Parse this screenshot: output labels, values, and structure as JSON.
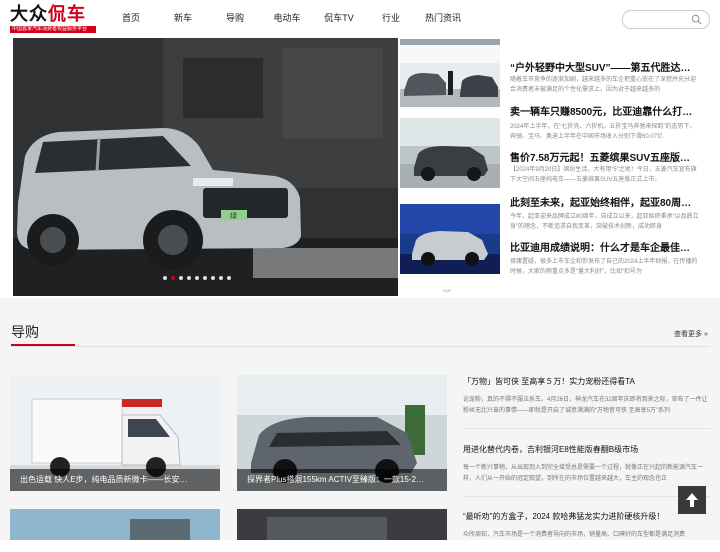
{
  "header": {
    "logo_text_1": "大众",
    "logo_text_2": "侃车",
    "logo_tagline": "中国首家汽车消费者权益服务平台",
    "nav": [
      {
        "label": "首页",
        "active": true
      },
      {
        "label": "新车",
        "active": false
      },
      {
        "label": "导购",
        "active": false
      },
      {
        "label": "电动车",
        "active": false
      },
      {
        "label": "侃车TV",
        "active": false
      },
      {
        "label": "行业",
        "active": false
      },
      {
        "label": "热门资讯",
        "active": false
      }
    ],
    "search": {
      "placeholder": "",
      "icon": "search-icon"
    }
  },
  "hero": {
    "slide_count": 9,
    "active_slide": 2,
    "plate": "绿"
  },
  "side_news": [
    {
      "title": "“户外轻野中大型SUV”——第五代胜达…",
      "desc": "随着车市竞争的逐渐加剧，越来越多的车企把重心放在了深挖并充分迎合消费者未被满足的个性化需求上。因为对于越来越多的"
    },
    {
      "title": "卖一辆车只赚8500元，比亚迪靠什么打…",
      "desc": "2024年上半年，在“七折壳、六折机，五折宝马奔驰来探韵”的态势下，奔驰、宝马、奥迪上半年在中国市场收入分别下滑60.07亿"
    },
    {
      "title": "售价7.58万元起！五菱缤果SUV五座版…",
      "desc": "【2024年9月20日】缤纷生活，大有用“5”之地！今日，五菱汽车宣布旗下大空间五座纯电车——五菱缤果SUV五座版正式上市，"
    },
    {
      "title": "此刻至未来，起亚始终相伴，起亚80周…",
      "desc": "今年，起亚迎来品牌成立80周年，自成立以来，起亚始终秉承“以品质立身”的理念，不断追求自我变革，突破技术创新，成功跻身"
    },
    {
      "title": "比亚迪用成绩说明：什么才是车企最佳…",
      "desc": "毋庸置疑，很多上市车企和你发布了自己的2024上半年财报，在传播的时候，大家的侧重点多是“量大利好”，比如“扣号为"
    }
  ],
  "more_arrows": "︾",
  "guide": {
    "title": "导购",
    "view_more": "查看更多 »",
    "cards": [
      {
        "caption": "出色运载 快人E步，纯电品质新微卡——长安…"
      },
      {
        "caption": "探界者Plus搭混155km ACTIV至臻版：一款15-2…"
      },
      {
        "caption": ""
      },
      {
        "caption": ""
      }
    ],
    "news": [
      {
        "title": "「万物」皆可侠 至高享５万！实力宠粉还得看TA",
        "desc": "论宠粉，真的不得不服法系车。4月26日，神龙汽车在32周年庆即将到来之际，官布了一件让粉丝无比兴奋的事情——即就是开启了诚意满满的“万物皆可侠 至高享5万”系列"
      },
      {
        "title": "用进化替代内卷，吉利银河E8性能版春翻B级市场",
        "desc": "每一个新兴事物，从出现到入到完全接受总是需要一个过程，就像正在兴起的新能源汽车一样，人们从一开始的冠定观望，到所在的市场位置越来越大，车主的观念也正"
      },
      {
        "title": "“最听劝”的方盒子，2024 款哈弗猛龙实力进阶硬核升级！",
        "desc": "众所周知，汽车市场是一个消费者导向的市场，销量高、口碑好的车型都是满足消费"
      }
    ]
  },
  "colors": {
    "accent": "#d0021b",
    "section_bg": "#f5f5f5"
  },
  "back_to_top_icon": "arrow-up-icon"
}
